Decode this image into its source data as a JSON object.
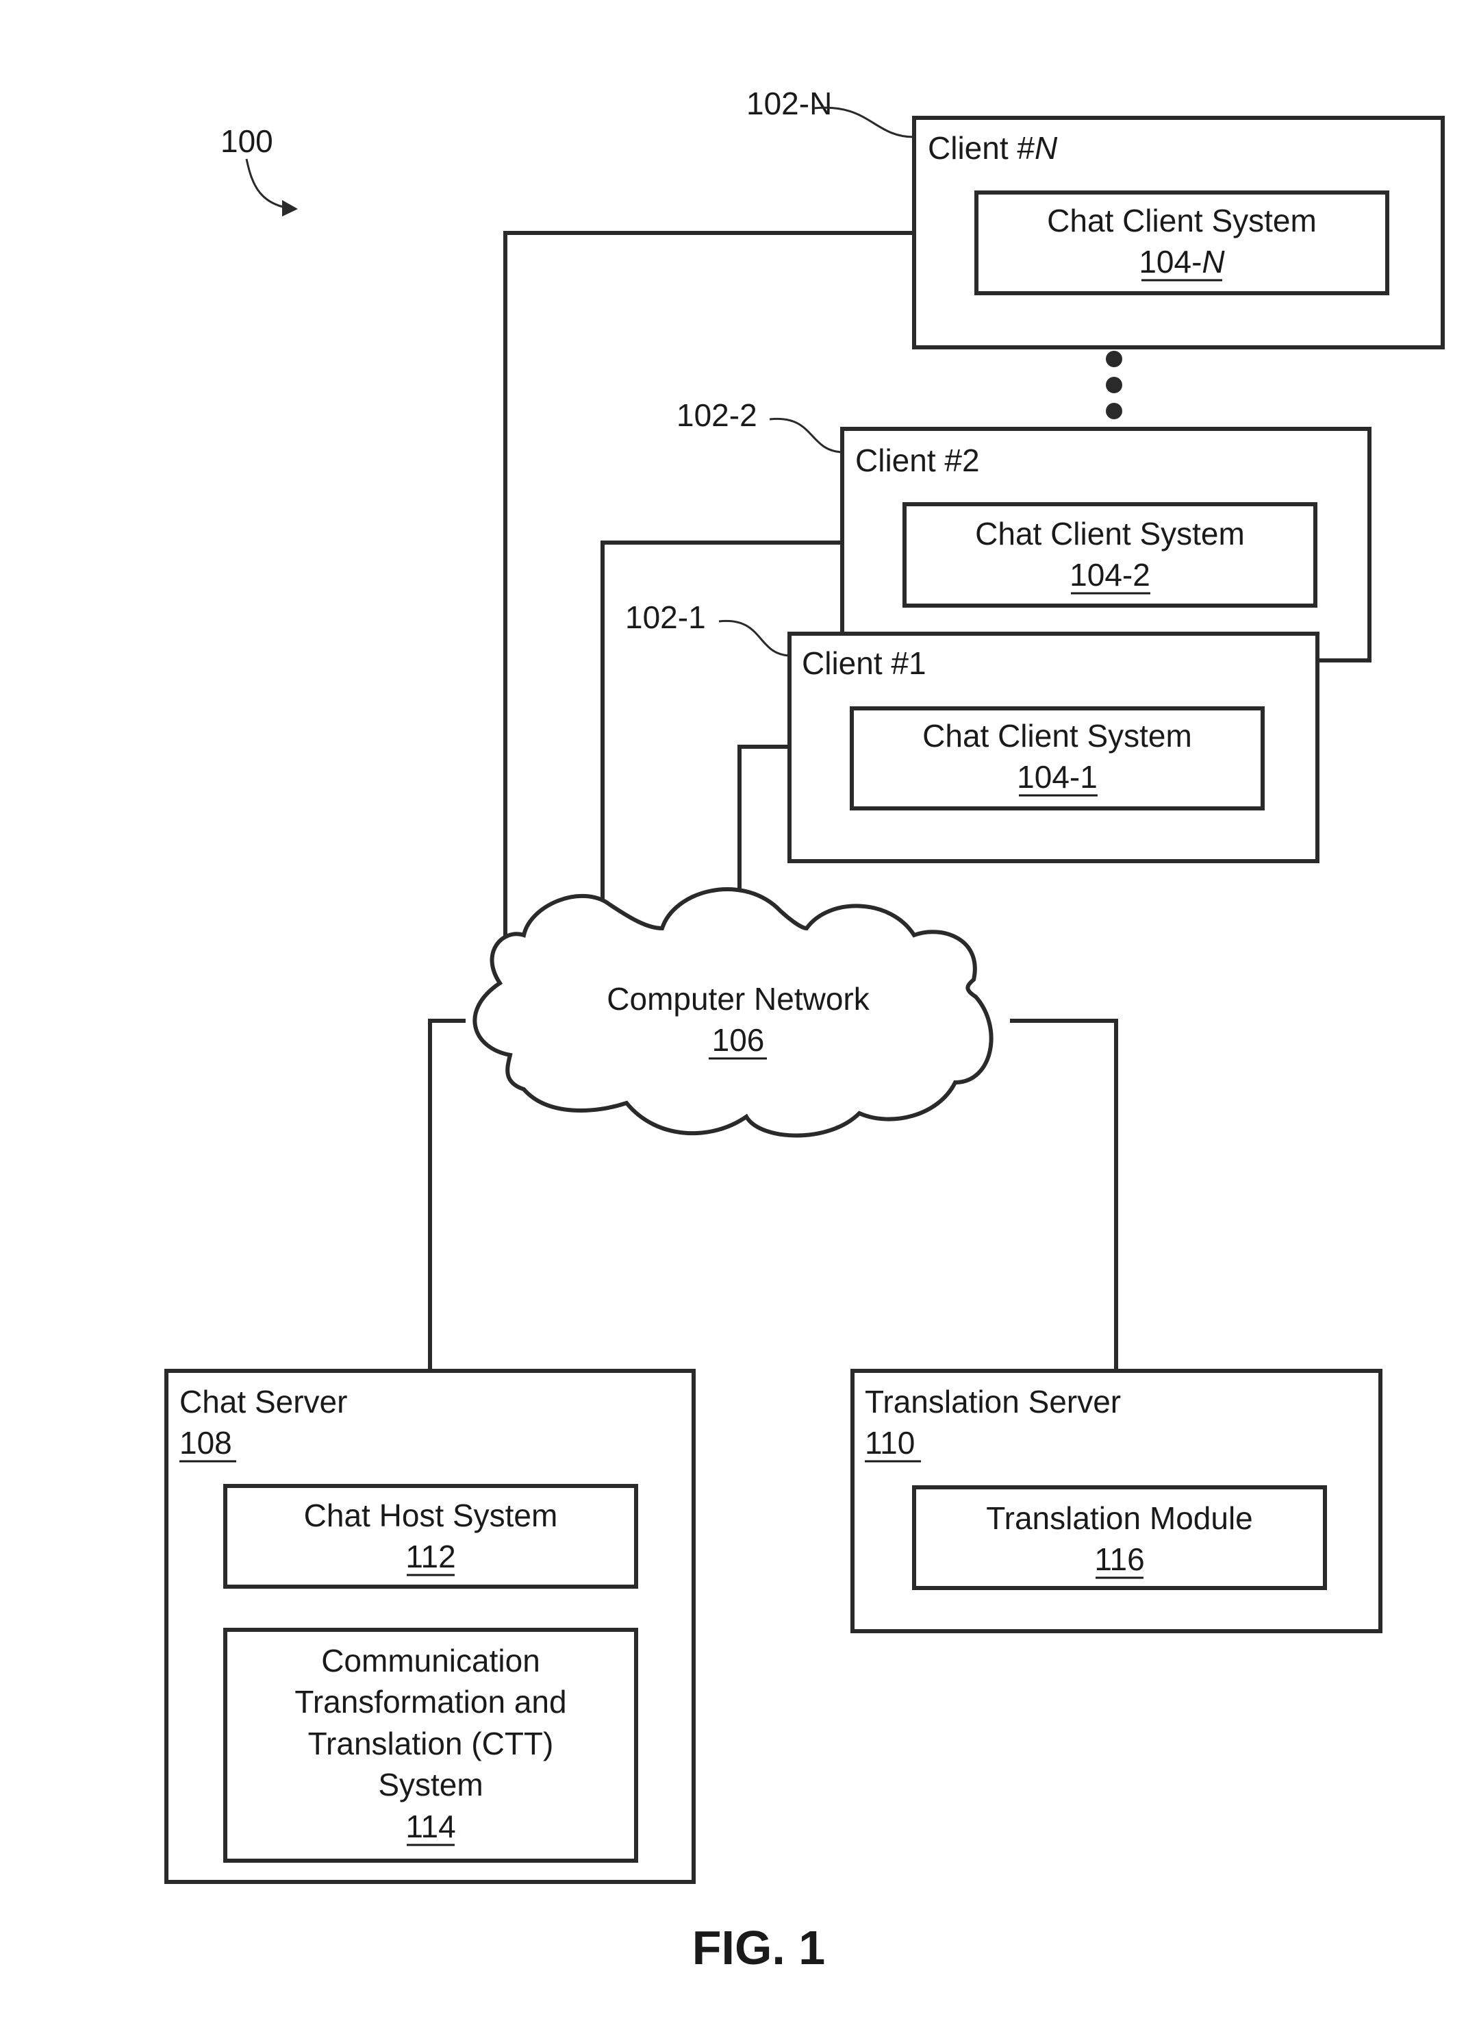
{
  "figure": {
    "system_ref": "100",
    "caption": "FIG. 1"
  },
  "clients": [
    {
      "ref": "102-N",
      "title_prefix": "Client #",
      "title_suffix": "N",
      "inner_label": "Chat Client System",
      "inner_ref_prefix": "104-",
      "inner_ref_suffix": "N"
    },
    {
      "ref": "102-2",
      "title": "Client #2",
      "inner_label": "Chat Client System",
      "inner_ref": "104-2"
    },
    {
      "ref": "102-1",
      "title": "Client #1",
      "inner_label": "Chat Client System",
      "inner_ref": "104-1"
    }
  ],
  "ellipsis": "⋮",
  "network": {
    "label": "Computer Network",
    "ref": "106"
  },
  "chat_server": {
    "title": "Chat Server",
    "ref": "108",
    "host": {
      "label": "Chat Host System",
      "ref": "112"
    },
    "ctt": {
      "lines": [
        "Communication",
        "Transformation and",
        "Translation (CTT)",
        "System"
      ],
      "ref": "114"
    }
  },
  "translation_server": {
    "title": "Translation Server",
    "ref": "110",
    "module": {
      "label": "Translation Module",
      "ref": "116"
    }
  }
}
